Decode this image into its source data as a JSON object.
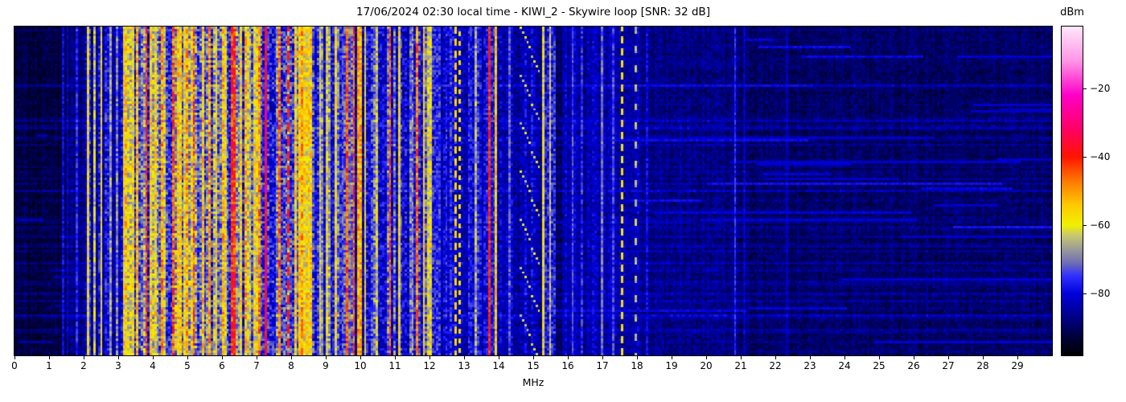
{
  "chart_data": {
    "type": "heatmap",
    "subtype": "radio-spectrogram-waterfall",
    "title": "17/06/2024 02:30 local time - KIWI_2 - Skywire loop [SNR: 32 dB]",
    "xlabel": "MHz",
    "x_range": [
      0,
      30
    ],
    "x_ticks": [
      0,
      1,
      2,
      3,
      4,
      5,
      6,
      7,
      8,
      9,
      10,
      11,
      12,
      13,
      14,
      15,
      16,
      17,
      18,
      19,
      20,
      21,
      22,
      23,
      24,
      25,
      26,
      27,
      28,
      29
    ],
    "y_axis": "time (no tick labels shown)",
    "grid": false,
    "colorbar": {
      "label": "dBm",
      "range": [
        -98,
        -2
      ],
      "ticks": [
        {
          "v": -20,
          "label": "−20"
        },
        {
          "v": -40,
          "label": "−40"
        },
        {
          "v": -60,
          "label": "−60"
        },
        {
          "v": -80,
          "label": "−80"
        }
      ]
    },
    "colormap_anchors": [
      [
        -98,
        "#000000"
      ],
      [
        -92,
        "#000042"
      ],
      [
        -86,
        "#000092"
      ],
      [
        -80,
        "#0000d8"
      ],
      [
        -75,
        "#2e2eff"
      ],
      [
        -71,
        "#6e6eb6"
      ],
      [
        -67,
        "#9a9a98"
      ],
      [
        -63,
        "#c8c86e"
      ],
      [
        -60,
        "#f0f000"
      ],
      [
        -54,
        "#ffc800"
      ],
      [
        -47,
        "#ff7800"
      ],
      [
        -40,
        "#ff1400"
      ],
      [
        -32,
        "#ff0064"
      ],
      [
        -22,
        "#ff00c8"
      ],
      [
        -12,
        "#ff96e6"
      ],
      [
        -2,
        "#ffe6fa"
      ]
    ],
    "bands": [
      {
        "from": 0,
        "to": 1.55,
        "base": -93,
        "col_var": 1.5,
        "cell_var": 2.5
      },
      {
        "from": 1.55,
        "to": 2.05,
        "base": -88,
        "col_var": 3,
        "cell_var": 4
      },
      {
        "from": 2.05,
        "to": 2.62,
        "base": -82,
        "col_var": 6,
        "cell_var": 6
      },
      {
        "from": 2.62,
        "to": 3.16,
        "base": -81,
        "col_var": 5,
        "cell_var": 6
      },
      {
        "from": 3.16,
        "to": 8.67,
        "base": -67,
        "col_var": 11,
        "cell_var": 8
      },
      {
        "from": 8.67,
        "to": 9.55,
        "base": -74,
        "col_var": 8,
        "cell_var": 7
      },
      {
        "from": 9.55,
        "to": 12.1,
        "base": -77,
        "col_var": 7,
        "cell_var": 7
      },
      {
        "from": 12.1,
        "to": 14.1,
        "base": -81,
        "col_var": 5,
        "cell_var": 6
      },
      {
        "from": 14.1,
        "to": 15.25,
        "base": -84,
        "col_var": 4,
        "cell_var": 5
      },
      {
        "from": 15.25,
        "to": 15.65,
        "base": -73,
        "col_var": 6,
        "cell_var": 6
      },
      {
        "from": 15.65,
        "to": 15.85,
        "base": -92,
        "col_var": 2,
        "cell_var": 3
      },
      {
        "from": 15.85,
        "to": 18.1,
        "base": -85,
        "col_var": 3.5,
        "cell_var": 4.5
      },
      {
        "from": 18.1,
        "to": 21,
        "base": -88.5,
        "col_var": 2,
        "cell_var": 3.5
      },
      {
        "from": 21,
        "to": 30,
        "base": -90.5,
        "col_var": 1.5,
        "cell_var": 3
      }
    ],
    "signals": [
      [
        1.42,
        0.02,
        -79
      ],
      [
        1.53,
        0.02,
        -80
      ],
      [
        1.81,
        0.02,
        -77
      ],
      [
        2.12,
        0.025,
        -60
      ],
      [
        2.3,
        0.02,
        -64
      ],
      [
        2.51,
        0.025,
        -58
      ],
      [
        2.78,
        0.02,
        -68
      ],
      [
        2.98,
        0.02,
        -70
      ],
      [
        3.25,
        0.03,
        -56
      ],
      [
        3.42,
        0.03,
        -60
      ],
      [
        3.58,
        0.03,
        -53
      ],
      [
        3.81,
        0.025,
        -43
      ],
      [
        3.95,
        0.03,
        -56
      ],
      [
        4.1,
        0.03,
        -58
      ],
      [
        4.3,
        0.03,
        -52
      ],
      [
        4.62,
        0.025,
        -46
      ],
      [
        4.8,
        0.03,
        -57
      ],
      [
        5.0,
        0.03,
        -52
      ],
      [
        5.2,
        0.025,
        -47
      ],
      [
        5.45,
        0.03,
        -56
      ],
      [
        5.62,
        0.03,
        -50
      ],
      [
        5.85,
        0.03,
        -56
      ],
      [
        6.05,
        0.03,
        -52
      ],
      [
        6.31,
        0.05,
        -41
      ],
      [
        6.52,
        0.03,
        -51
      ],
      [
        6.7,
        0.03,
        -55
      ],
      [
        6.85,
        0.025,
        -45
      ],
      [
        7.1,
        0.03,
        -50
      ],
      [
        7.27,
        0.028,
        -36
      ],
      [
        7.5,
        0.03,
        -54
      ],
      [
        7.64,
        0.025,
        -48
      ],
      [
        7.93,
        0.035,
        -40,
        [
          6,
          0.55,
          2
        ]
      ],
      [
        8.12,
        0.03,
        -55
      ],
      [
        8.3,
        0.03,
        -52
      ],
      [
        8.5,
        0.03,
        -56
      ],
      [
        8.85,
        0.03,
        -62
      ],
      [
        9.05,
        0.03,
        -60
      ],
      [
        9.3,
        0.03,
        -58
      ],
      [
        9.64,
        0.022,
        -44
      ],
      [
        9.83,
        0.022,
        -45
      ],
      [
        9.98,
        0.05,
        -54
      ],
      [
        10.15,
        0.03,
        -60
      ],
      [
        10.45,
        0.03,
        -63
      ],
      [
        10.87,
        0.022,
        -44
      ],
      [
        11.1,
        0.03,
        -58
      ],
      [
        11.35,
        0.03,
        -55
      ],
      [
        11.62,
        0.025,
        -47
      ],
      [
        11.85,
        0.05,
        -58
      ],
      [
        12.0,
        0.04,
        -60
      ],
      [
        12.4,
        0.02,
        -70
      ],
      [
        12.75,
        0.025,
        -56,
        [
          5,
          0.5,
          0
        ]
      ],
      [
        12.88,
        0.02,
        -58,
        [
          4,
          0.5,
          2
        ]
      ],
      [
        13.1,
        0.022,
        -55,
        [
          5,
          0.5,
          1
        ]
      ],
      [
        13.35,
        0.02,
        -68
      ],
      [
        13.74,
        0.04,
        -42
      ],
      [
        13.95,
        0.03,
        -55
      ],
      [
        14.3,
        0.02,
        -72
      ],
      [
        14.55,
        0.02,
        -68,
        [
          7,
          0.5,
          3
        ]
      ],
      [
        15.32,
        0.03,
        -60
      ],
      [
        15.5,
        0.03,
        -63
      ],
      [
        16.05,
        0.02,
        -72
      ],
      [
        16.15,
        0.02,
        -74
      ],
      [
        16.4,
        0.02,
        -76
      ],
      [
        17.0,
        0.02,
        -72
      ],
      [
        17.3,
        0.02,
        -76
      ],
      [
        17.57,
        0.022,
        -58,
        [
          5,
          0.45,
          1
        ]
      ],
      [
        17.95,
        0.02,
        -64,
        [
          8,
          0.35,
          0
        ]
      ],
      [
        18.3,
        0.02,
        -80
      ],
      [
        19.05,
        0.02,
        -74,
        [
          9,
          0.4,
          2
        ]
      ],
      [
        19.23,
        0.018,
        -78
      ],
      [
        20.84,
        0.018,
        -76
      ],
      [
        21.1,
        0.018,
        -82
      ],
      [
        22.35,
        0.018,
        -84
      ]
    ],
    "gaps": [
      [
        4.52,
        0.09,
        -77
      ],
      [
        5.32,
        0.06,
        -76
      ],
      [
        6.15,
        0.04,
        -75
      ],
      [
        7.45,
        0.1,
        -78
      ],
      [
        8.02,
        0.05,
        -75
      ]
    ],
    "chirp": {
      "f_min": 14.62,
      "f_max": 15.28,
      "f_base": 14.66,
      "span": 0.55,
      "period_rows": 20,
      "width": 0.03,
      "lvl": -62
    },
    "noise": {
      "seed": 1337,
      "rows": 137,
      "cols": 460,
      "streaks_right": {
        "count": 30,
        "f_lo": 15.3,
        "f_hi": 28.5,
        "len_min": 0.5,
        "len_max": 10,
        "lvl": -80
      },
      "streaks_left": {
        "count": 8,
        "f_lo": 0.05,
        "f_hi": 1.4,
        "len_min": 0.3,
        "len_max": 1.4,
        "lvl": -86
      }
    }
  }
}
